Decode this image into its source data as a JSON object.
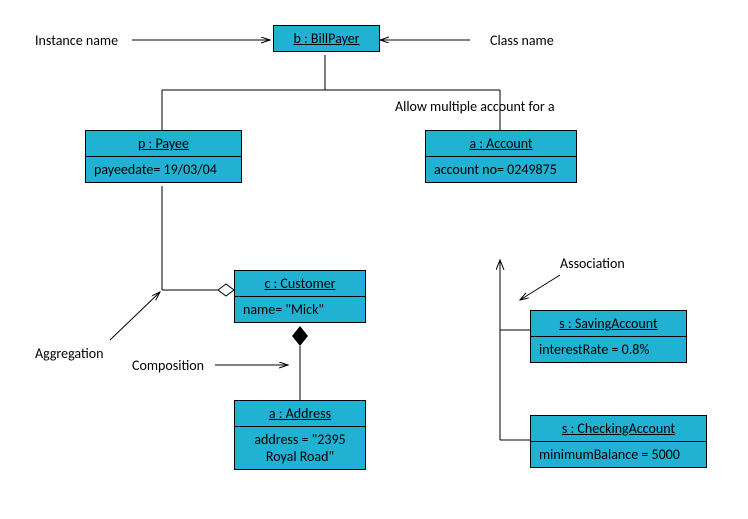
{
  "labels": {
    "instanceName": "Instance name",
    "className": "Class name",
    "allowMultiple": "Allow multiple account for a",
    "aggregation": "Aggregation",
    "composition": "Composition",
    "association": "Association"
  },
  "objects": {
    "billPayer": {
      "title": "b : BillPayer"
    },
    "payee": {
      "title": "p : Payee",
      "attr": "payeedate= 19/03/04"
    },
    "account": {
      "title": "a : Account",
      "attr": "account no= 0249875"
    },
    "customer": {
      "title": "c : Customer",
      "attr": "name= \"Mick\""
    },
    "address": {
      "title": "a : Address",
      "attr": "address = \"2395 Royal Road\""
    },
    "savingAccount": {
      "title": "s : SavingAccount",
      "attr": "interestRate = 0.8%"
    },
    "checkingAccount": {
      "title": "s : CheckingAccount",
      "attr": "minimumBalance = 5000"
    }
  },
  "chart_data": {
    "type": "uml-object-diagram",
    "title": "UML Object Diagram",
    "nodes": [
      {
        "id": "b",
        "instance": "b",
        "class": "BillPayer",
        "attributes": {}
      },
      {
        "id": "p",
        "instance": "p",
        "class": "Payee",
        "attributes": {
          "payeedate": "19/03/04"
        }
      },
      {
        "id": "a",
        "instance": "a",
        "class": "Account",
        "attributes": {
          "account no": "0249875"
        }
      },
      {
        "id": "c",
        "instance": "c",
        "class": "Customer",
        "attributes": {
          "name": "Mick"
        }
      },
      {
        "id": "addr",
        "instance": "a",
        "class": "Address",
        "attributes": {
          "address": "2395 Royal Road"
        }
      },
      {
        "id": "sSav",
        "instance": "s",
        "class": "SavingAccount",
        "attributes": {
          "interestRate": "0.8%"
        }
      },
      {
        "id": "sChk",
        "instance": "s",
        "class": "CheckingAccount",
        "attributes": {
          "minimumBalance": 5000
        }
      }
    ],
    "edges": [
      {
        "from": "b",
        "to": "p",
        "type": "association"
      },
      {
        "from": "b",
        "to": "a",
        "type": "association",
        "label": "Allow multiple account for a"
      },
      {
        "from": "p",
        "to": "c",
        "type": "aggregation"
      },
      {
        "from": "c",
        "to": "addr",
        "type": "composition"
      },
      {
        "from": "a",
        "to": "sSav",
        "type": "association"
      },
      {
        "from": "a",
        "to": "sChk",
        "type": "association"
      }
    ],
    "annotations": [
      {
        "text": "Instance name",
        "points_to": "b-instance"
      },
      {
        "text": "Class name",
        "points_to": "b-class"
      },
      {
        "text": "Aggregation",
        "points_to": "p-c-edge"
      },
      {
        "text": "Composition",
        "points_to": "c-addr-edge"
      },
      {
        "text": "Association",
        "points_to": "a-s-edge"
      }
    ]
  }
}
